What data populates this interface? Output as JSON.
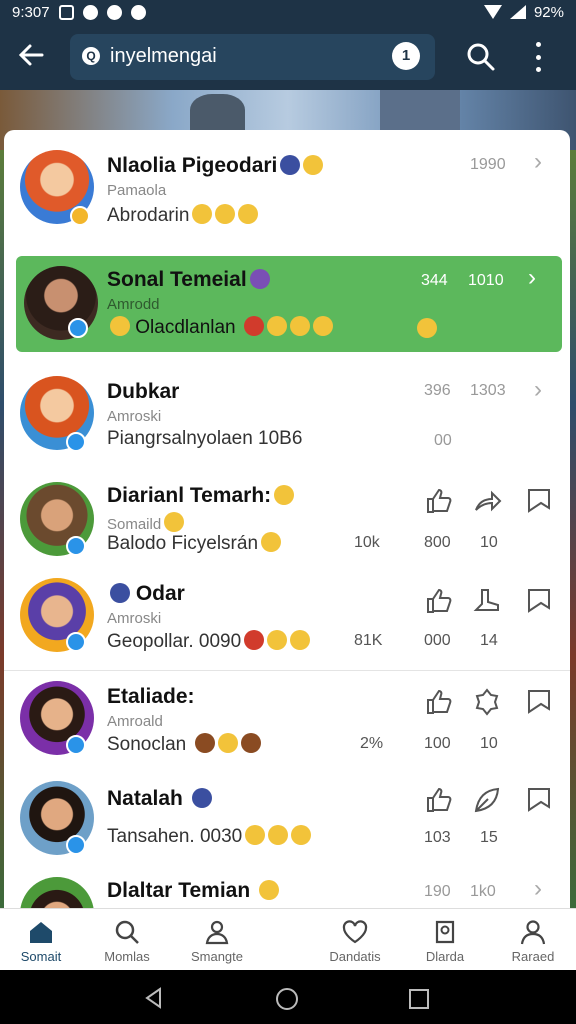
{
  "status": {
    "time": "9:307",
    "battery": "92%"
  },
  "search": {
    "query": "inyelmengai",
    "mic_label": "1"
  },
  "contacts": [
    {
      "name": "Nlaolia Pigeodari",
      "sub": "Pamaola",
      "line2": "Abrodarin",
      "count1": "1990",
      "count2": ""
    },
    {
      "name": "Sonal Temeial",
      "sub": "Amrodd",
      "line2": "Olacdlanlan",
      "count1": "344",
      "count2": "1010"
    },
    {
      "name": "Dubkar",
      "sub": "Amroski",
      "line2": "Piangrsalnyolaen",
      "line2_extra": "10B6",
      "count1": "396",
      "count2": "1303",
      "count3": "00"
    },
    {
      "name": "Diarianl Temarh:",
      "sub": "Somaild",
      "line2": "Balodo Ficyelsrán",
      "count1": "10k",
      "count2": "800",
      "count3": "10"
    },
    {
      "name": "Odar",
      "sub": "Amroski",
      "line2": "Geopollar.",
      "line2_extra": "0090",
      "count1": "81K",
      "count2": "000",
      "count3": "14"
    },
    {
      "name": "Etaliade:",
      "sub": "Amroald",
      "line2": "Sonoclan",
      "count1": "2%",
      "count2": "100",
      "count3": "10"
    },
    {
      "name": "Natalah",
      "sub": "",
      "line2": "Tansahen.",
      "line2_extra": "0030",
      "count1": "",
      "count2": "103",
      "count3": "15"
    },
    {
      "name": "Dlaltar Temian",
      "sub": "",
      "line2": "",
      "count1": "190",
      "count2": "1k0"
    }
  ],
  "nav": [
    {
      "label": "Somait",
      "icon": "home-icon"
    },
    {
      "label": "Momlas",
      "icon": "search-icon"
    },
    {
      "label": "Smangte",
      "icon": "group-icon"
    },
    {
      "label": "Dandatis",
      "icon": "heart-icon"
    },
    {
      "label": "Dlarda",
      "icon": "shield-icon"
    },
    {
      "label": "Raraed",
      "icon": "person-icon"
    }
  ],
  "colors": {
    "appbar": "#1e3346",
    "selected_row": "#5cb85c",
    "accent": "#2a93e8"
  }
}
